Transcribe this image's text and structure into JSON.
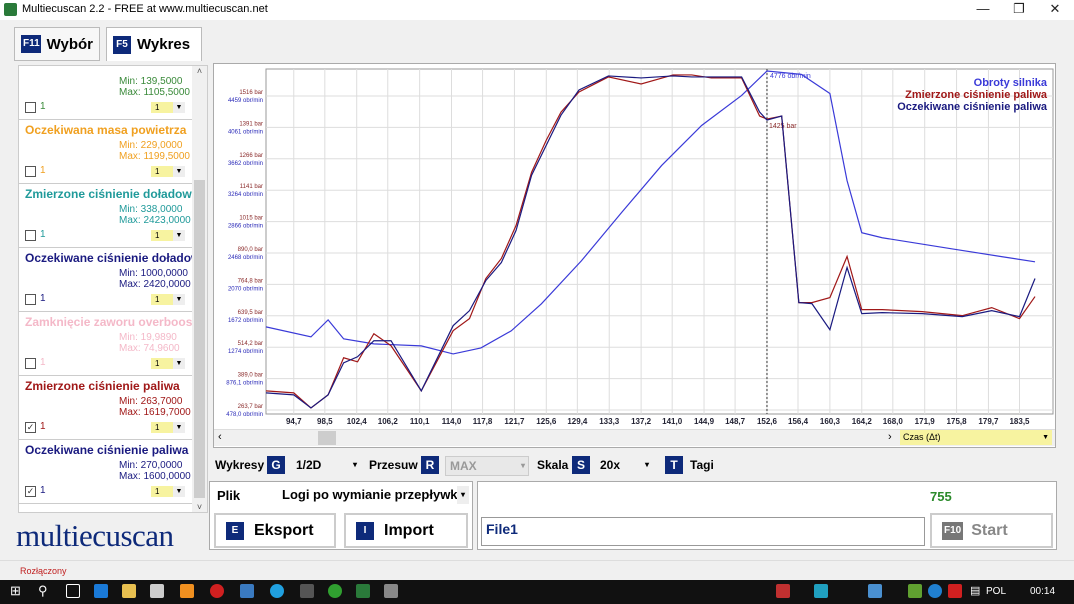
{
  "window": {
    "title": "Multiecuscan 2.2 - FREE at www.multiecuscan.net",
    "minimize": "—",
    "restore": "❐",
    "close": "✕"
  },
  "tabs": [
    {
      "key": "F11",
      "label": "Wybór"
    },
    {
      "key": "F5",
      "label": "Wykres"
    }
  ],
  "params": [
    {
      "name": "",
      "min": "Min: 139,5000",
      "max": "Max: 1105,5000",
      "checked": false,
      "count": "1",
      "scale": "1",
      "color": "#3a8a3a"
    },
    {
      "name": "Oczekiwana masa powietrza",
      "min": "Min: 229,0000",
      "max": "Max: 1199,5000",
      "checked": false,
      "count": "1",
      "scale": "1",
      "color": "#f0a020"
    },
    {
      "name": "Zmierzone ciśnienie doładowa",
      "min": "Min: 338,0000",
      "max": "Max: 2423,0000",
      "checked": false,
      "count": "1",
      "scale": "1",
      "color": "#209a9a"
    },
    {
      "name": "Oczekiwane ciśnienie doładow",
      "min": "Min: 1000,0000",
      "max": "Max: 2420,0000",
      "checked": false,
      "count": "1",
      "scale": "1",
      "color": "#1a1a80"
    },
    {
      "name": "Zamknięcie zaworu overboost",
      "min": "Min: 19,9890",
      "max": "Max: 74,9600",
      "checked": false,
      "count": "1",
      "scale": "1",
      "color": "#f4b8c8"
    },
    {
      "name": "Zmierzone ciśnienie paliwa",
      "min": "Min: 263,7000",
      "max": "Max: 1619,7000",
      "checked": true,
      "count": "1",
      "scale": "1",
      "color": "#a01818"
    },
    {
      "name": "Oczekiwane ciśnienie paliwa",
      "min": "Min: 270,0000",
      "max": "Max: 1600,0000",
      "checked": true,
      "count": "1",
      "scale": "1",
      "color": "#1a1a80"
    }
  ],
  "logo": "multiecuscan",
  "chart_data": {
    "type": "line",
    "xlabel": "Czas (Δt)",
    "x_ticks": [
      "94,7",
      "98,5",
      "102,4",
      "106,2",
      "110,1",
      "114,0",
      "117,8",
      "121,7",
      "125,6",
      "129,4",
      "133,3",
      "137,2",
      "141,0",
      "144,9",
      "148,7",
      "152,6",
      "156,4",
      "160,3",
      "164,2",
      "168,0",
      "171,9",
      "175,8",
      "179,7",
      "183,5"
    ],
    "x_tick_values": [
      94.7,
      98.5,
      102.4,
      106.2,
      110.1,
      114.0,
      117.8,
      121.7,
      125.6,
      129.4,
      133.3,
      137.2,
      141.0,
      144.9,
      148.7,
      152.6,
      156.4,
      160.3,
      164.2,
      168.0,
      171.9,
      175.8,
      179.7,
      183.5
    ],
    "xlim": [
      91.3,
      187.6
    ],
    "y_bar_ticks": [
      "263,7 bar",
      "389,0 bar",
      "514,2 bar",
      "639,5 bar",
      "764,8 bar",
      "890,0 bar",
      "1015 bar",
      "1141 bar",
      "1266 bar",
      "1391 bar",
      "1516 bar"
    ],
    "y_rpm_ticks": [
      "478,0 obr/min",
      "876,1 obr/min",
      "1274 obr/min",
      "1672 obr/min",
      "2070 obr/min",
      "2468 obr/min",
      "2866 obr/min",
      "3264 obr/min",
      "3662 obr/min",
      "4061 obr/min",
      "4459 obr/min"
    ],
    "ylim_bar": [
      263.7,
      1516
    ],
    "ylim_rpm": [
      478,
      4459
    ],
    "grid": true,
    "legend_position": "top-right",
    "cursor": {
      "x": 152.6,
      "rpm_label": "4776 obr/min",
      "bar_label": "1425 bar"
    },
    "series": [
      {
        "name": "Obroty silnika",
        "axis": "rpm",
        "color": "#3a3ad8",
        "x": [
          91.3,
          96.8,
          98.9,
          100.8,
          104.5,
          110.3,
          114.2,
          117.6,
          121.3,
          125.0,
          129.9,
          134.8,
          139.7,
          144.6,
          149.5,
          152.6,
          156.8,
          160.3,
          162.4,
          164.2,
          166.7,
          175.2,
          181.4,
          185.4
        ],
        "y": [
          1532,
          1405,
          1621,
          1380,
          1316,
          1291,
          1189,
          1265,
          1481,
          1824,
          2370,
          2980,
          3577,
          4085,
          4466,
          4776,
          4733,
          4491,
          3386,
          2726,
          2662,
          2522,
          2421,
          2357
        ]
      },
      {
        "name": "Zmierzone ciśnienie paliwa",
        "axis": "bar",
        "color": "#a01818",
        "x": [
          91.3,
          94.7,
          96.8,
          98.9,
          100.8,
          102.5,
          104.5,
          106.6,
          110.3,
          114.2,
          116.2,
          118.2,
          120.1,
          121.9,
          123.8,
          125.6,
          127.4,
          129.6,
          133.2,
          137.2,
          141.1,
          143.4,
          145.8,
          149.5,
          151.7,
          152.6,
          154.4,
          156.5,
          158.1,
          160.3,
          162.4,
          164.2,
          166.7,
          171.6,
          176.5,
          180.1,
          183.5,
          185.4
        ],
        "y": [
          340,
          332,
          272,
          324,
          472,
          456,
          568,
          520,
          340,
          580,
          628,
          788,
          868,
          1000,
          1212,
          1340,
          1452,
          1532,
          1592,
          1564,
          1600,
          1600,
          1588,
          1588,
          1436,
          1424,
          1436,
          692,
          692,
          712,
          876,
          664,
          664,
          656,
          640,
          672,
          628,
          716
        ]
      },
      {
        "name": "Oczekiwane ciśnienie paliwa",
        "axis": "bar",
        "color": "#1a1a80",
        "x": [
          91.3,
          94.7,
          96.8,
          98.9,
          100.8,
          102.5,
          104.5,
          106.6,
          110.3,
          114.2,
          116.2,
          118.2,
          120.1,
          121.9,
          123.8,
          125.6,
          127.4,
          129.6,
          133.2,
          137.2,
          141.1,
          143.4,
          145.8,
          149.5,
          151.7,
          152.6,
          154.4,
          156.5,
          158.1,
          160.3,
          162.4,
          164.2,
          166.7,
          171.6,
          176.5,
          180.1,
          183.5,
          185.4
        ],
        "y": [
          332,
          324,
          272,
          324,
          452,
          476,
          540,
          540,
          340,
          600,
          660,
          780,
          852,
          980,
          1200,
          1320,
          1440,
          1540,
          1596,
          1588,
          1596,
          1592,
          1592,
          1592,
          1452,
          1420,
          1436,
          692,
          688,
          584,
          832,
          648,
          652,
          648,
          636,
          660,
          636,
          788
        ]
      }
    ]
  },
  "controls": {
    "wykresy_label": "Wykresy",
    "wykresy_key": "G",
    "wykresy_value": "1/2D",
    "przesuw_label": "Przesuw",
    "przesuw_key": "R",
    "przesuw_value": "MAX",
    "skala_label": "Skala",
    "skala_key": "S",
    "skala_value": "20x",
    "tagi_key": "T",
    "tagi_label": "Tagi"
  },
  "file": {
    "label": "Plik",
    "value": "Logi po wymianie przepływk",
    "export_key": "E",
    "export": "Eksport",
    "import_key": "I",
    "import": "Import"
  },
  "run": {
    "count": "755",
    "file_name": "File1",
    "start_key": "F10",
    "start": "Start"
  },
  "status": "Rozłączony",
  "taskbar": {
    "lang": "POL",
    "time": "00:14"
  }
}
